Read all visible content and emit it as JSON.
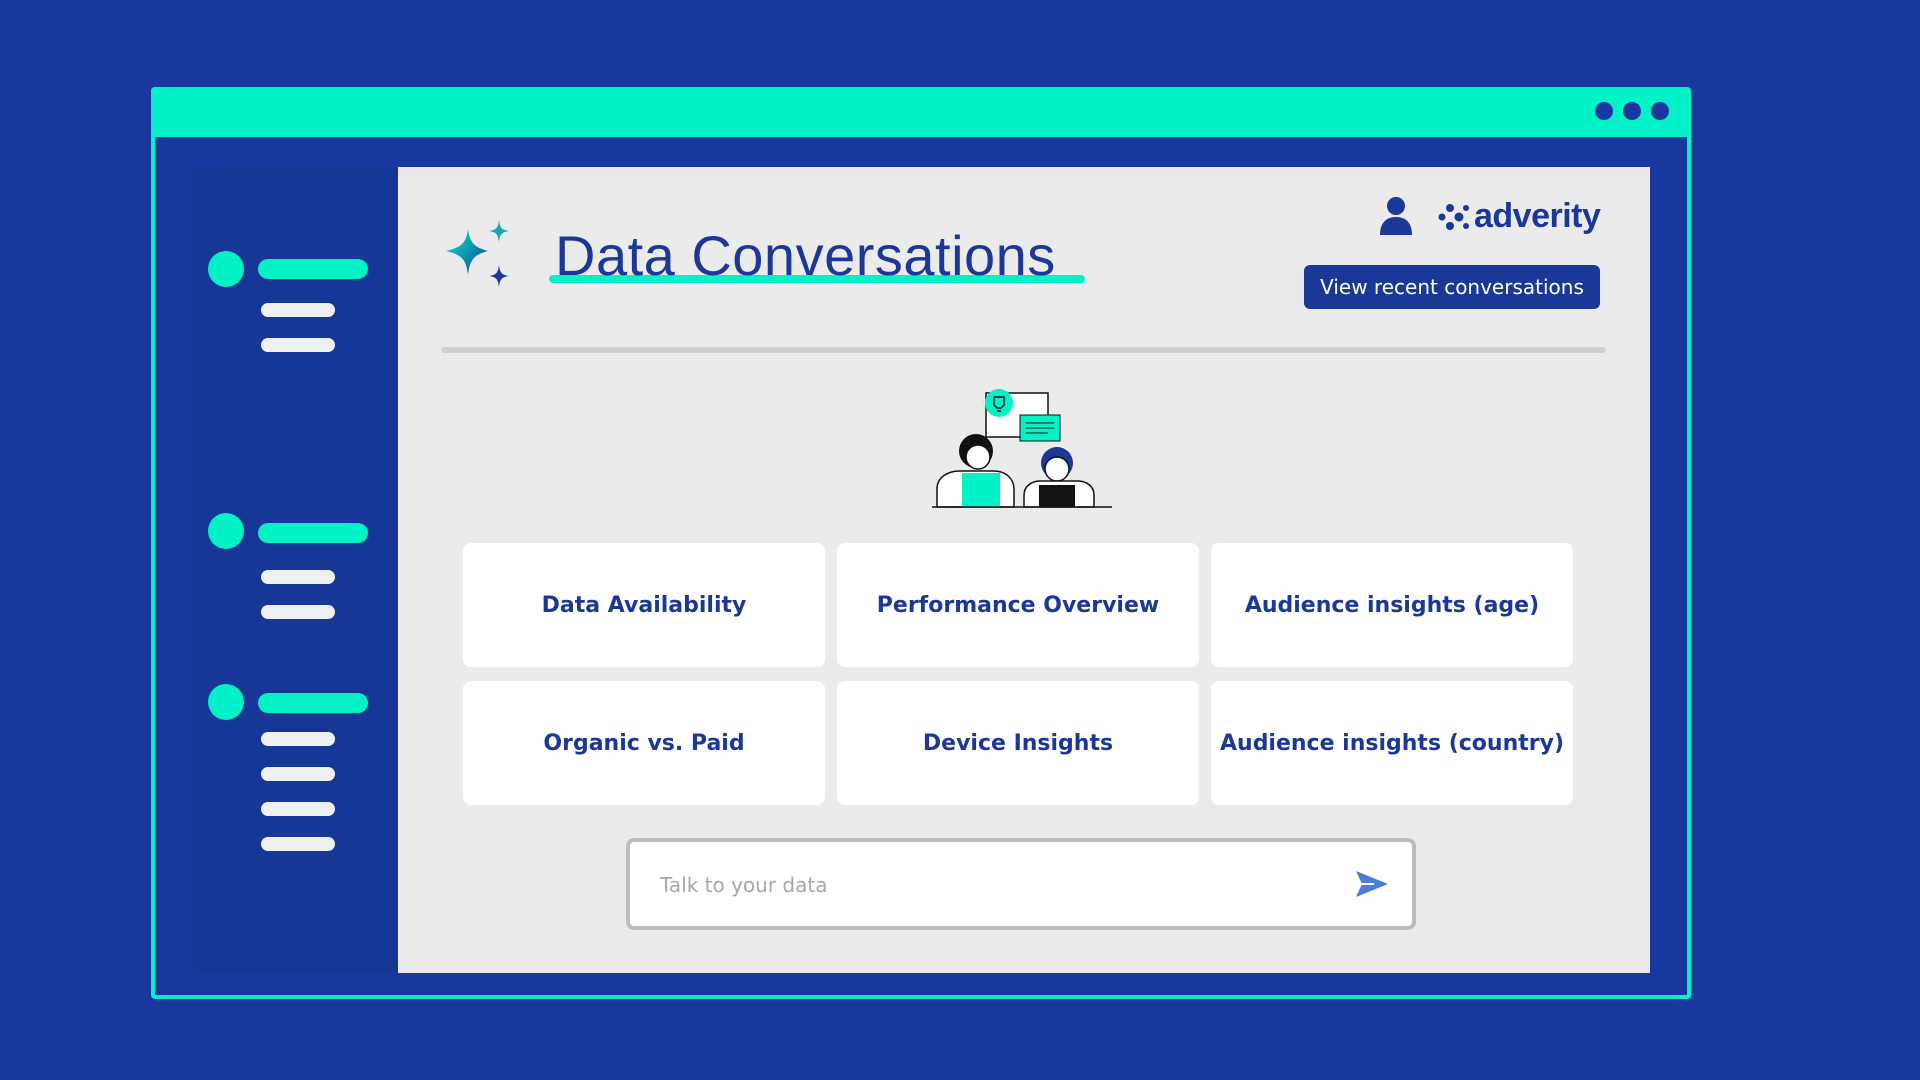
{
  "app": {
    "title": "Data Conversations",
    "brand_name": "adverity",
    "recent_button": "View recent conversations"
  },
  "sidebar": {
    "groups": [
      {
        "sub_items": 2
      },
      {
        "sub_items": 2
      },
      {
        "sub_items": 4
      }
    ]
  },
  "prompts": [
    {
      "label": "Data Availability"
    },
    {
      "label": "Performance Overview"
    },
    {
      "label": "Audience insights (age)"
    },
    {
      "label": "Organic vs. Paid"
    },
    {
      "label": "Device Insights"
    },
    {
      "label": "Audience insights (country)"
    }
  ],
  "chat": {
    "placeholder": "Talk to your data",
    "value": ""
  },
  "icons": {
    "title": "sparkle-icon",
    "user": "user-icon",
    "brand": "adverity-logo-icon",
    "send": "send-icon",
    "illustration": "people-conversation-icon",
    "window_controls": "more-dots-icon"
  },
  "colors": {
    "background": "#1838a0",
    "accent": "#01f2c6",
    "brand": "#1b3798",
    "panel": "#ebebeb",
    "sidebar": "#173796"
  }
}
